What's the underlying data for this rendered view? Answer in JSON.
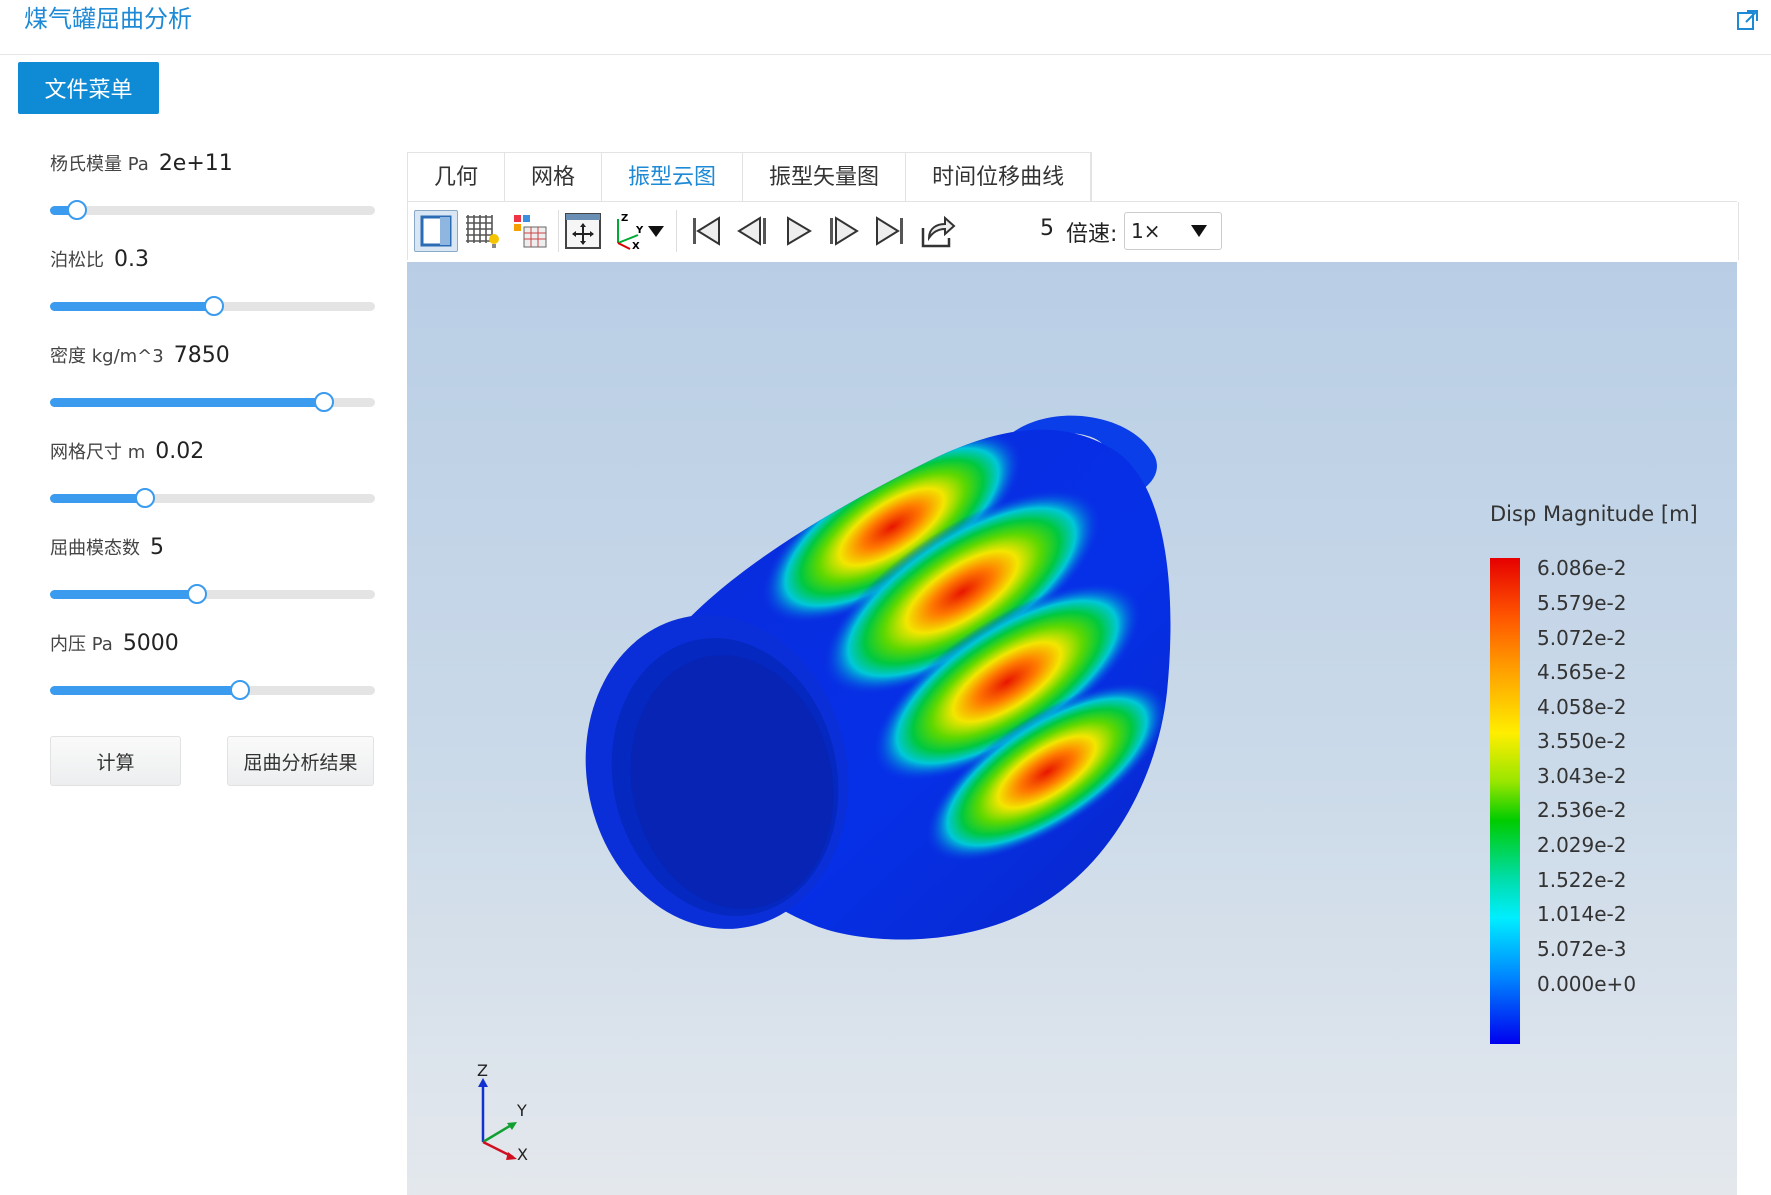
{
  "app": {
    "title": "煤气罐屈曲分析"
  },
  "file_menu": {
    "label": "文件菜单"
  },
  "params": [
    {
      "label": "杨氏模量 Pa",
      "value": "2e+11",
      "fraction": 0.08
    },
    {
      "label": "泊松比",
      "value": "0.3",
      "fraction": 0.5
    },
    {
      "label": "密度 kg/m^3",
      "value": "7850",
      "fraction": 0.84
    },
    {
      "label": "网格尺寸 m",
      "value": "0.02",
      "fraction": 0.29
    },
    {
      "label": "屈曲模态数",
      "value": "5",
      "fraction": 0.45
    },
    {
      "label": "内压 Pa",
      "value": "5000",
      "fraction": 0.58
    }
  ],
  "buttons": {
    "compute": "计算",
    "result": "屈曲分析结果"
  },
  "tabs": [
    {
      "label": "几何",
      "active": false
    },
    {
      "label": "网格",
      "active": false
    },
    {
      "label": "振型云图",
      "active": true
    },
    {
      "label": "振型矢量图",
      "active": false
    },
    {
      "label": "时间位移曲线",
      "active": false
    }
  ],
  "toolbar": {
    "frame": "5",
    "speed_label": "倍速:",
    "speed_value": "1×"
  },
  "toolbar_icons": [
    "solid-view-icon",
    "mesh-view-icon",
    "light-icon",
    "reset-view-icon",
    "axis-orientation-icon",
    "first-frame-icon",
    "prev-frame-icon",
    "play-icon",
    "next-frame-icon",
    "last-frame-icon",
    "export-icon"
  ],
  "legend": {
    "title": "Disp Magnitude [m]",
    "ticks": [
      "6.086e-2",
      "5.579e-2",
      "5.072e-2",
      "4.565e-2",
      "4.058e-2",
      "3.550e-2",
      "3.043e-2",
      "2.536e-2",
      "2.029e-2",
      "1.522e-2",
      "1.014e-2",
      "5.072e-3",
      "0.000e+0"
    ]
  },
  "axes": {
    "z": "Z",
    "y": "Y",
    "x": "X"
  },
  "colors": {
    "accent": "#1e8ad6",
    "slider": "#3a9bef",
    "menu_button": "#0f8ad5"
  }
}
